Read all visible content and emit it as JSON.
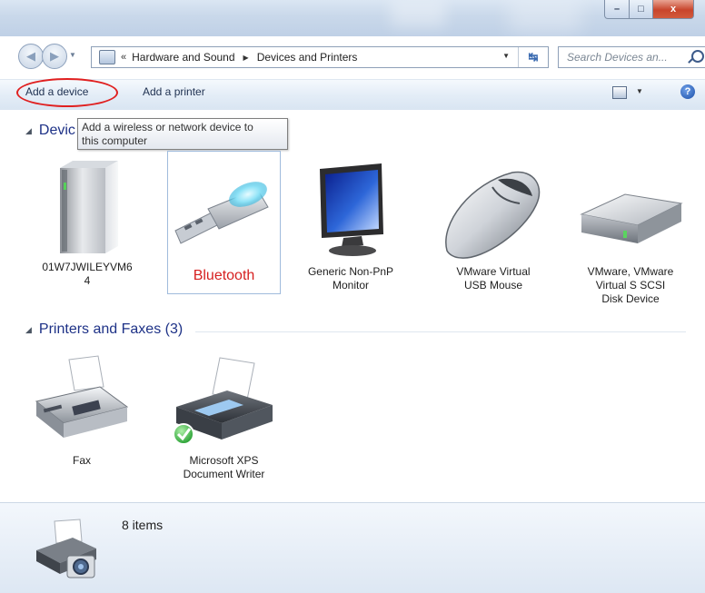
{
  "window": {
    "controls": {
      "minimize": "–",
      "maximize": "□",
      "close": "x"
    }
  },
  "nav": {
    "back_icon": "◀",
    "forward_icon": "▶",
    "breadcrumb_prefix": "«",
    "breadcrumbs": [
      "Hardware and Sound",
      "Devices and Printers"
    ],
    "search_placeholder": "Search Devices an..."
  },
  "toolbar": {
    "add_device": "Add a device",
    "add_printer": "Add a printer",
    "help": "?"
  },
  "tooltip": {
    "line1": "Add a wireless or network device to",
    "line2": "this computer"
  },
  "devices": {
    "heading": "Devic",
    "items": [
      {
        "label_line1": "01W7JWILEYVM6",
        "label_line2": "4",
        "icon": "computer-tower-icon"
      },
      {
        "label_line1": "Bluetooth",
        "label_line2": "",
        "icon": "usb-bluetooth-dongle-icon"
      },
      {
        "label_line1": "Generic Non-PnP",
        "label_line2": "Monitor",
        "icon": "monitor-icon"
      },
      {
        "label_line1": "VMware Virtual",
        "label_line2": "USB Mouse",
        "icon": "mouse-icon"
      },
      {
        "label_line1": "VMware, VMware",
        "label_line2": "Virtual S SCSI",
        "label_line3": "Disk Device",
        "icon": "hard-disk-icon"
      }
    ]
  },
  "printers": {
    "heading": "Printers and Faxes (3)",
    "items": [
      {
        "label_line1": "Fax",
        "label_line2": "",
        "icon": "fax-icon"
      },
      {
        "label_line1": "Microsoft XPS",
        "label_line2": "Document Writer",
        "icon": "printer-default-icon"
      }
    ]
  },
  "status": {
    "count": "8 items"
  },
  "colors": {
    "highlight_ring": "#e02020",
    "bluetooth_label": "#d62020",
    "group_heading": "#1e3287"
  }
}
